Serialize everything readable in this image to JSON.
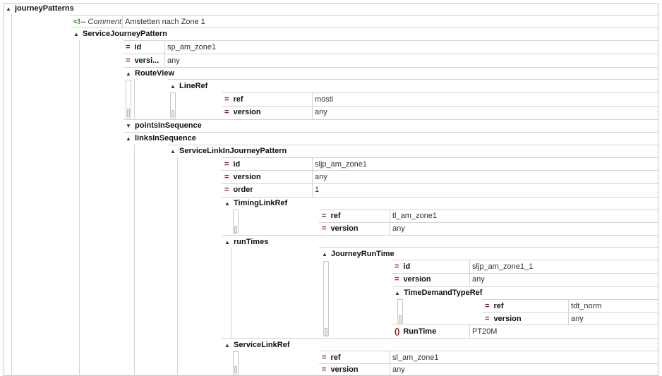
{
  "root": {
    "label": "journeyPatterns",
    "toggle": "▲"
  },
  "comment": {
    "label": "Comment",
    "value": "Amstetten nach Zone 1",
    "icon": "<!--"
  },
  "sjp": {
    "label": "ServiceJourneyPattern",
    "id": {
      "name": "id",
      "value": "sp_am_zone1"
    },
    "version": {
      "name": "versi...",
      "value": "any"
    },
    "routeView": {
      "label": "RouteView",
      "lineRef": {
        "label": "LineRef",
        "ref": {
          "name": "ref",
          "value": "mosti"
        },
        "version": {
          "name": "version",
          "value": "any"
        }
      }
    },
    "pointsInSequence": {
      "label": "pointsInSequence",
      "toggle": "▼"
    },
    "linksInSequence": {
      "label": "linksInSequence",
      "link": {
        "label": "ServiceLinkInJourneyPattern",
        "id": {
          "name": "id",
          "value": "sljp_am_zone1"
        },
        "version": {
          "name": "version",
          "value": "any"
        },
        "order": {
          "name": "order",
          "value": "1"
        },
        "timingLinkRef": {
          "label": "TimingLinkRef",
          "ref": {
            "name": "ref",
            "value": "tl_am_zone1"
          },
          "version": {
            "name": "version",
            "value": "any"
          }
        },
        "runTimes": {
          "label": "runTimes",
          "jrt": {
            "label": "JourneyRunTime",
            "id": {
              "name": "id",
              "value": "sljp_am_zone1_1"
            },
            "version": {
              "name": "version",
              "value": "any"
            },
            "tdtRef": {
              "label": "TimeDemandTypeRef",
              "ref": {
                "name": "ref",
                "value": "tdt_norm"
              },
              "version": {
                "name": "version",
                "value": "any"
              }
            },
            "runTime": {
              "name": "RunTime",
              "value": "PT20M"
            }
          }
        },
        "serviceLinkRef": {
          "label": "ServiceLinkRef",
          "ref": {
            "name": "ref",
            "value": "sl_am_zone1"
          },
          "version": {
            "name": "version",
            "value": "any"
          }
        }
      }
    }
  },
  "icons": {
    "expanded": "▲",
    "collapsed": "▼",
    "attr": "=",
    "element": "()"
  },
  "colors": {
    "attr_icon": "#a01818",
    "comment_icon": "#2f7d22",
    "grid": "#d4d4d4"
  }
}
